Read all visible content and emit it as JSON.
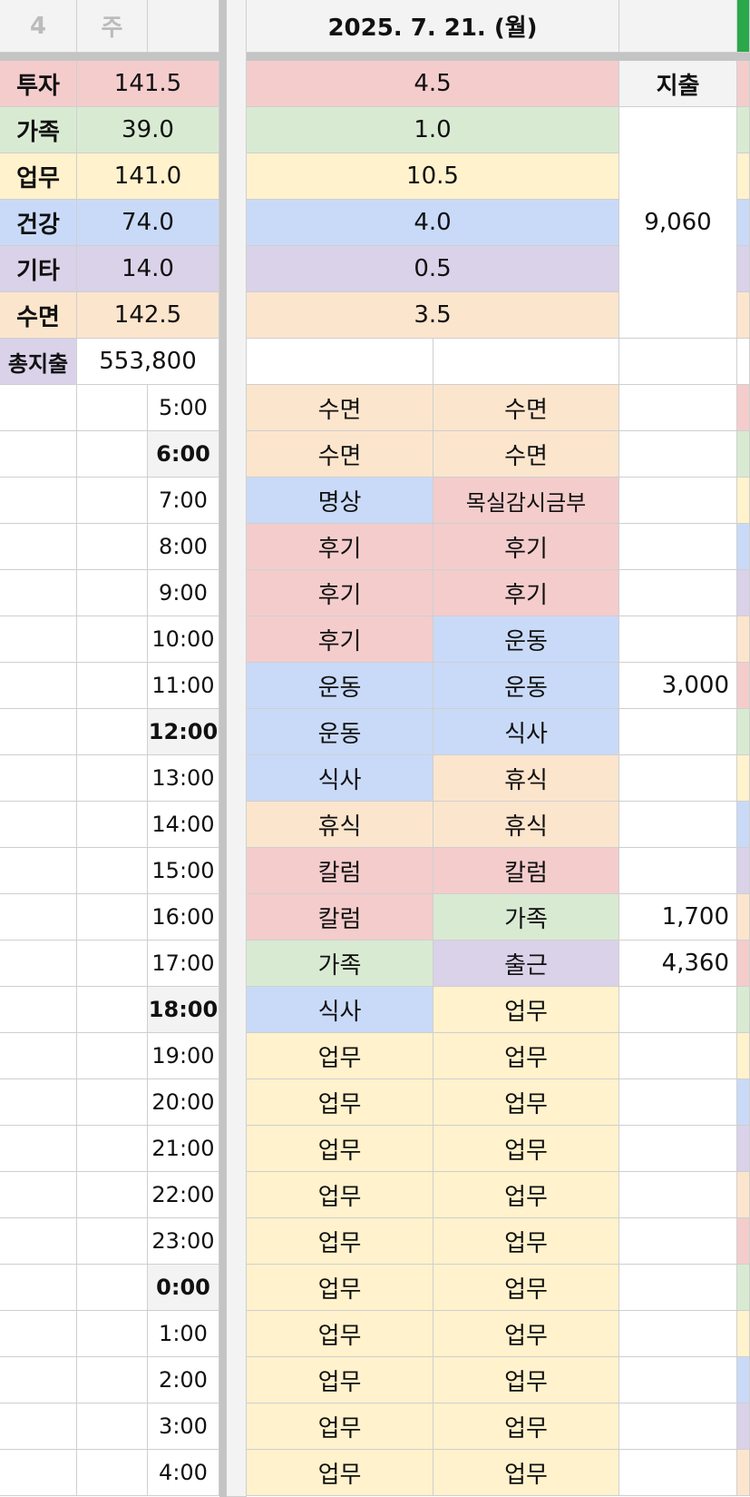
{
  "header": {
    "week_number": "4",
    "week_label": "주",
    "date": "2025. 7. 21. (월)",
    "expense_label": "지출"
  },
  "categories": [
    {
      "label": "투자",
      "total": "141.5",
      "day": "4.5",
      "color": "#f4cccc"
    },
    {
      "label": "가족",
      "total": "39.0",
      "day": "1.0",
      "color": "#d9ead3"
    },
    {
      "label": "업무",
      "total": "141.0",
      "day": "10.5",
      "color": "#fff2cc"
    },
    {
      "label": "건강",
      "total": "74.0",
      "day": "4.0",
      "color": "#c9daf8"
    },
    {
      "label": "기타",
      "total": "14.0",
      "day": "0.5",
      "color": "#d9d2e9"
    },
    {
      "label": "수면",
      "total": "142.5",
      "day": "3.5",
      "color": "#fce5cd"
    }
  ],
  "day_expense": "9,060",
  "total_expense": {
    "label": "총지출",
    "value": "553,800"
  },
  "schedule": [
    {
      "time": "5:00",
      "a": "수면",
      "b": "수면",
      "expense": ""
    },
    {
      "time": "6:00",
      "a": "수면",
      "b": "수면",
      "expense": ""
    },
    {
      "time": "7:00",
      "a": "명상",
      "b": "목실감시금부",
      "expense": ""
    },
    {
      "time": "8:00",
      "a": "후기",
      "b": "후기",
      "expense": ""
    },
    {
      "time": "9:00",
      "a": "후기",
      "b": "후기",
      "expense": ""
    },
    {
      "time": "10:00",
      "a": "후기",
      "b": "운동",
      "expense": ""
    },
    {
      "time": "11:00",
      "a": "운동",
      "b": "운동",
      "expense": "3,000"
    },
    {
      "time": "12:00",
      "a": "운동",
      "b": "식사",
      "expense": ""
    },
    {
      "time": "13:00",
      "a": "식사",
      "b": "휴식",
      "expense": ""
    },
    {
      "time": "14:00",
      "a": "휴식",
      "b": "휴식",
      "expense": ""
    },
    {
      "time": "15:00",
      "a": "칼럼",
      "b": "칼럼",
      "expense": ""
    },
    {
      "time": "16:00",
      "a": "칼럼",
      "b": "가족",
      "expense": "1,700"
    },
    {
      "time": "17:00",
      "a": "가족",
      "b": "출근",
      "expense": "4,360"
    },
    {
      "time": "18:00",
      "a": "식사",
      "b": "업무",
      "expense": ""
    },
    {
      "time": "19:00",
      "a": "업무",
      "b": "업무",
      "expense": ""
    },
    {
      "time": "20:00",
      "a": "업무",
      "b": "업무",
      "expense": ""
    },
    {
      "time": "21:00",
      "a": "업무",
      "b": "업무",
      "expense": ""
    },
    {
      "time": "22:00",
      "a": "업무",
      "b": "업무",
      "expense": ""
    },
    {
      "time": "23:00",
      "a": "업무",
      "b": "업무",
      "expense": ""
    },
    {
      "time": "0:00",
      "a": "업무",
      "b": "업무",
      "expense": ""
    },
    {
      "time": "1:00",
      "a": "업무",
      "b": "업무",
      "expense": ""
    },
    {
      "time": "2:00",
      "a": "업무",
      "b": "업무",
      "expense": ""
    },
    {
      "time": "3:00",
      "a": "업무",
      "b": "업무",
      "expense": ""
    },
    {
      "time": "4:00",
      "a": "업무",
      "b": "업무",
      "expense": ""
    }
  ]
}
